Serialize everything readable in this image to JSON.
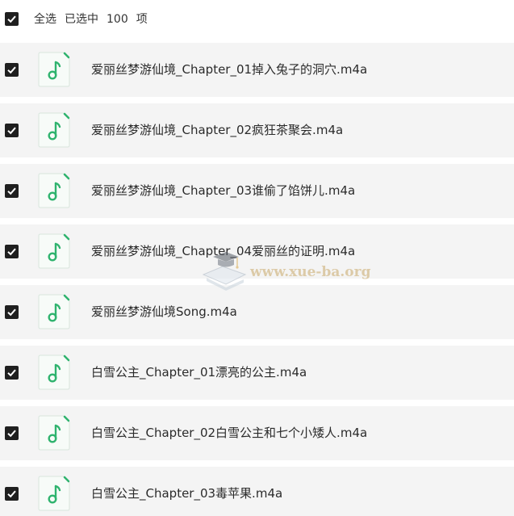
{
  "header": {
    "select_all_label": "全选",
    "selected_prefix": "已选中",
    "selected_count": "100",
    "selected_suffix": "项",
    "checked": true
  },
  "files": [
    {
      "name": "爱丽丝梦游仙境_Chapter_01掉入兔子的洞穴.m4a",
      "checked": true
    },
    {
      "name": "爱丽丝梦游仙境_Chapter_02疯狂茶聚会.m4a",
      "checked": true
    },
    {
      "name": "爱丽丝梦游仙境_Chapter_03谁偷了馅饼儿.m4a",
      "checked": true
    },
    {
      "name": "爱丽丝梦游仙境_Chapter_04爱丽丝的证明.m4a",
      "checked": true
    },
    {
      "name": "爱丽丝梦游仙境Song.m4a",
      "checked": true
    },
    {
      "name": "白雪公主_Chapter_01漂亮的公主.m4a",
      "checked": true
    },
    {
      "name": "白雪公主_Chapter_02白雪公主和七个小矮人.m4a",
      "checked": true
    },
    {
      "name": "白雪公主_Chapter_03毒苹果.m4a",
      "checked": true
    }
  ],
  "file_icon": "music-file-icon",
  "watermark": {
    "text": "www.xue-ba.org"
  },
  "colors": {
    "checkbox": "#1f1f1f",
    "row_background": "#f4f4f4",
    "icon_green": "#2fb36e"
  }
}
